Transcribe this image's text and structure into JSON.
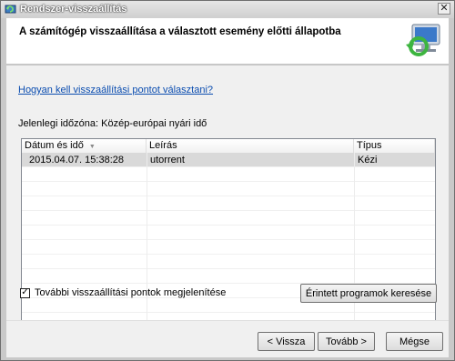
{
  "window": {
    "title": "Rendszer-visszaállítás",
    "close_glyph": "✕"
  },
  "header": {
    "title": "A számítógép visszaállítása a választott esemény előtti állapotba"
  },
  "body": {
    "help_link": "Hogyan kell visszaállítási pontot választani?",
    "timezone": "Jelenlegi időzóna: Közép-európai nyári idő"
  },
  "list": {
    "columns": [
      "Dátum és idő",
      "Leírás",
      "Típus"
    ],
    "rows": [
      {
        "date": "2015.04.07. 15:38:28",
        "description": "utorrent",
        "type": "Kézi"
      }
    ]
  },
  "options": {
    "show_more_label": "További visszaállítási pontok megjelenítése",
    "show_more_checked": true,
    "check_glyph": "✓"
  },
  "buttons": {
    "scan": "Érintett programok keresése",
    "back": "< Vissza",
    "next": "Tovább >",
    "cancel": "Mégse"
  },
  "colors": {
    "link": "#0b4db0",
    "selected_row": "#d9d9d9"
  }
}
